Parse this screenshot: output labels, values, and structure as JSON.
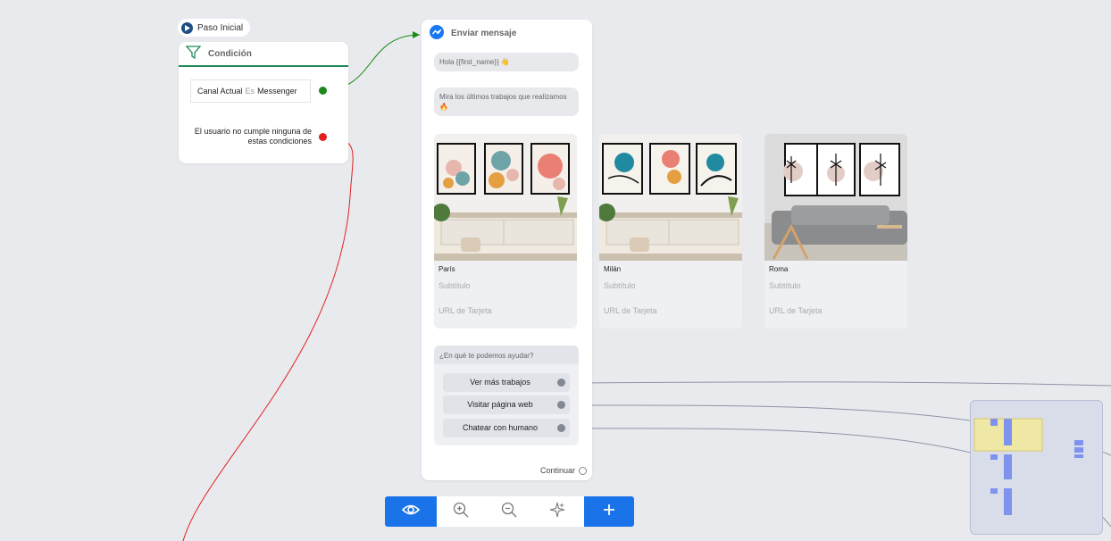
{
  "start": {
    "label": "Paso Inicial"
  },
  "condition_node": {
    "title": "Condición",
    "rule": {
      "field": "Canal Actual",
      "operator": "Es",
      "value": "Messenger"
    },
    "else_text": "El usuario no cumple ninguna de estas condiciones"
  },
  "message_node": {
    "title": "Enviar mensaje",
    "messages": [
      "Hola {{first_name}} 👋",
      "Mira los últimos trabajos que realizamos 🔥"
    ],
    "cards": [
      {
        "title": "París",
        "subtitle": "Subtítulo",
        "url": "URL de Tarjeta"
      },
      {
        "title": "Milán",
        "subtitle": "Subtítulo",
        "url": "URL de Tarjeta"
      },
      {
        "title": "Roma",
        "subtitle": "Subtítulo",
        "url": "URL de Tarjeta"
      }
    ],
    "quick_reply": {
      "question": "¿En qué te podemos ayudar?",
      "buttons": [
        "Ver más trabajos",
        "Visitar página web",
        "Chatear con humano"
      ]
    },
    "continue_label": "Continuar"
  },
  "toolbar": {
    "buttons": [
      "eye-icon",
      "zoom-in-icon",
      "zoom-out-icon",
      "magic-icon",
      "plus-icon"
    ]
  },
  "colors": {
    "accent_blue": "#1a73e8",
    "condition_green": "#1f8a5a",
    "true_dot": "#1a8a1a",
    "false_dot": "#e02020",
    "messenger_blue": "#1877f2"
  }
}
